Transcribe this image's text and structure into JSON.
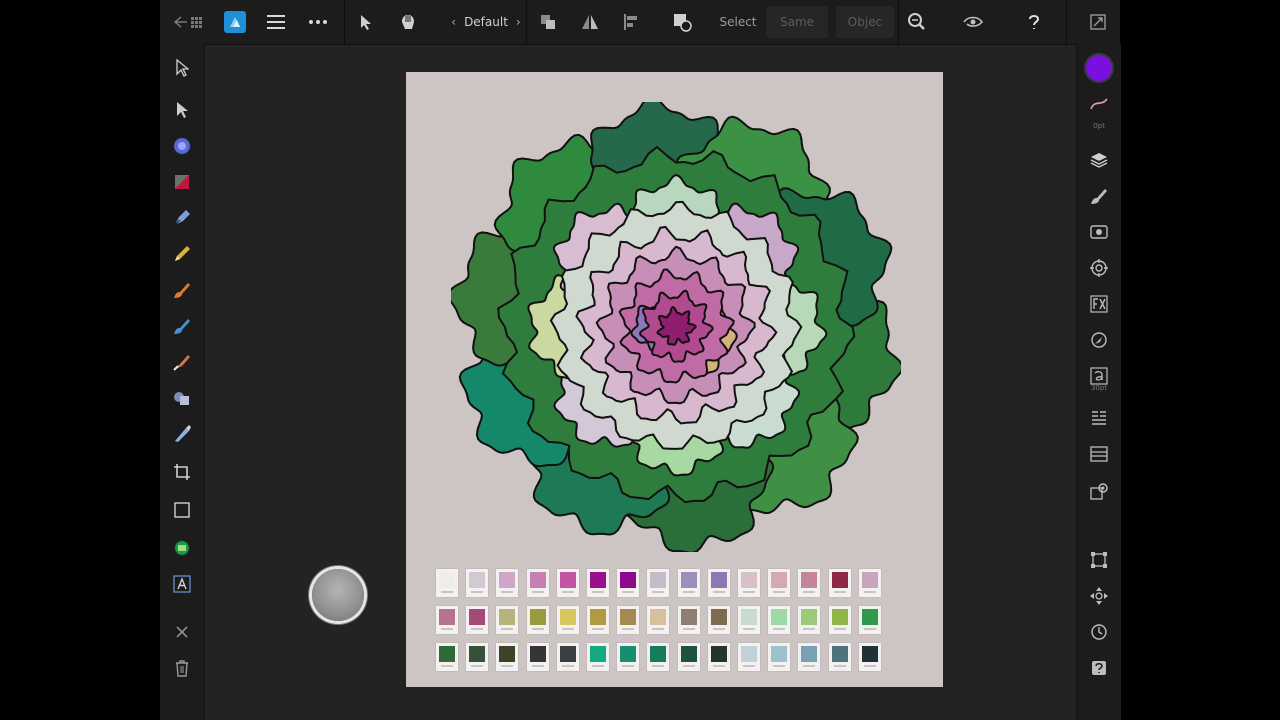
{
  "toolbar": {
    "persona_name": "Default",
    "select_label": "Select",
    "same_label": "Same",
    "object_label": "Objec"
  },
  "colors": {
    "primary_color": "#7a10e0",
    "canvas_bg": "#ccc5c4",
    "app_bg": "#232323"
  },
  "studio": {
    "stroke_width": "0pt",
    "text_size": "30pt"
  },
  "palette": {
    "rows": [
      [
        "#eeedeb",
        "#d3c9d3",
        "#cfa6c9",
        "#c57fb5",
        "#c055a0",
        "#9b0e8c",
        "#8e0a8a",
        "#c4bcc8",
        "#9d8fbb",
        "#8e77b4",
        "#d9bfc8",
        "#d5a8b4",
        "#c4849b",
        "#8f2947",
        "#c7a5bc"
      ],
      [
        "#b7738d",
        "#a54a77",
        "#b8b27b",
        "#9a9a3c",
        "#d9c65e",
        "#b39a3f",
        "#a68a54",
        "#d8c09e",
        "#8f7d72",
        "#7f6c50",
        "#c9dbd0",
        "#9fd8a7",
        "#9dca78",
        "#8db548",
        "#2f9b4a"
      ],
      [
        "#2f6a37",
        "#36503a",
        "#3e4228",
        "#353535",
        "#3b3f42",
        "#14a885",
        "#168f71",
        "#147d5d",
        "#1f5040",
        "#27332d",
        "#c1d1d7",
        "#9bc2c8",
        "#7aa1b1",
        "#4f737d",
        "#213139"
      ]
    ]
  }
}
